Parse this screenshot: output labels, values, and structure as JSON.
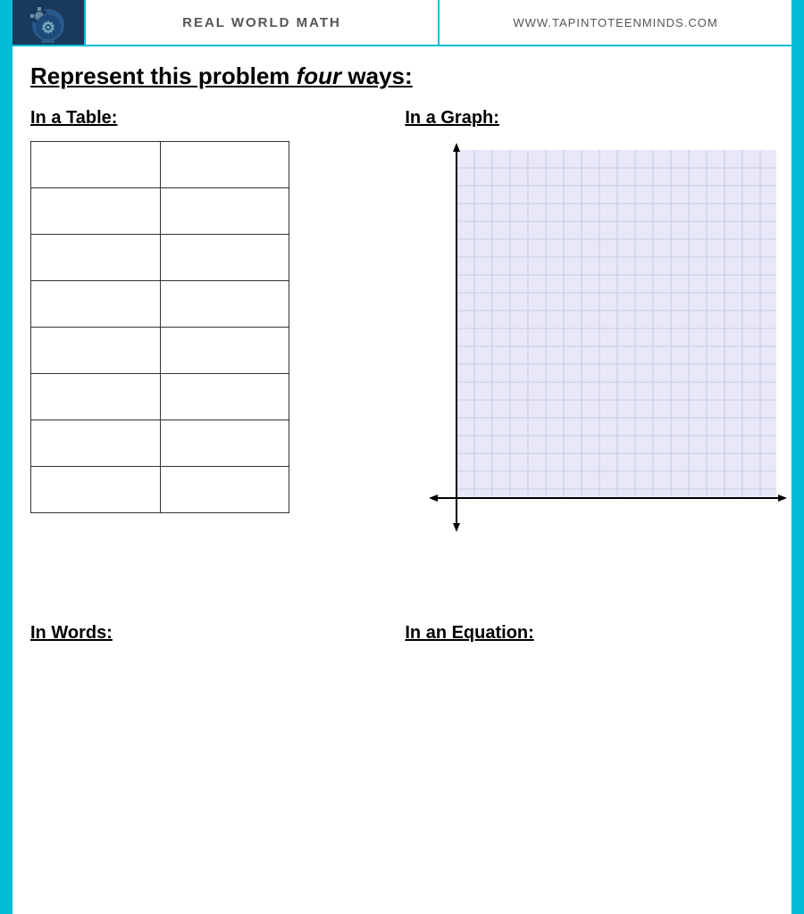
{
  "header": {
    "title": "REAL WORLD MATH",
    "website": "WWW.TAPINTOTEENMINDS.COM"
  },
  "main_heading": {
    "prefix": "Represent this problem ",
    "italic_word": "four",
    "suffix": " ways:"
  },
  "table_section": {
    "label": "In a Table:",
    "rows": 8,
    "cols": 2
  },
  "graph_section": {
    "label": "In a Graph:"
  },
  "words_section": {
    "label": "In Words:"
  },
  "equation_section": {
    "label": "In an Equation:"
  },
  "colors": {
    "cyan_border": "#00bcd4",
    "grid_fill": "#e8e8f8",
    "grid_line": "#c0c0e0",
    "axis_color": "#000"
  }
}
